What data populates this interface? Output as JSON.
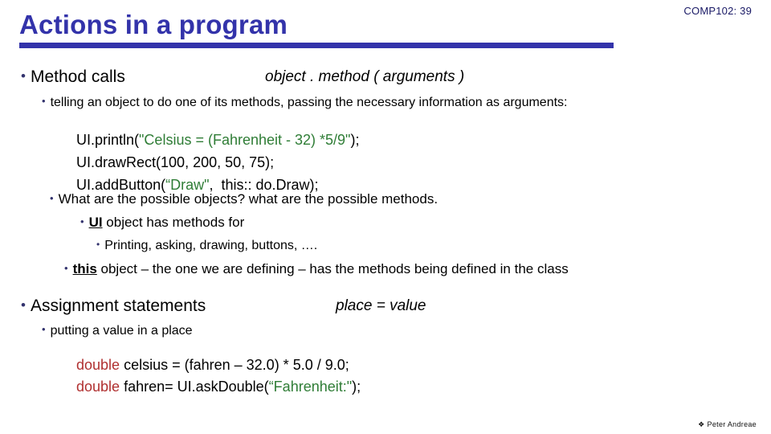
{
  "header": {
    "course_tag": "COMP102: 39",
    "title": "Actions in a program"
  },
  "sections": {
    "method_calls": {
      "heading": "Method calls",
      "syntax": "object . method  ( arguments  )",
      "description": "telling an object to do one of its methods, passing the necessary information as arguments:",
      "code_lines": [
        {
          "parts": [
            {
              "text": "UI.println(",
              "style": "plain"
            },
            {
              "text": "\"Celsius = (Fahrenheit - 32) *5/9\"",
              "style": "string"
            },
            {
              "text": ");",
              "style": "plain"
            }
          ]
        },
        {
          "parts": [
            {
              "text": "UI.drawRect(100, 200, 50, 75);",
              "style": "plain"
            }
          ]
        },
        {
          "parts": [
            {
              "text": "UI.addButton(",
              "style": "plain"
            },
            {
              "text": "“Draw\"",
              "style": "string"
            },
            {
              "text": ",  this:: do.Draw);",
              "style": "plain"
            }
          ]
        }
      ],
      "question": "What are the possible objects? what are the possible methods.",
      "ui_object": {
        "emph": "UI",
        "rest": " object has methods for"
      },
      "ui_methods": "Printing,  asking, drawing,  buttons,  ….",
      "this_object": {
        "emph": "this",
        "rest": "  object – the one we are defining – has the methods being defined in the class"
      }
    },
    "assignment": {
      "heading": "Assignment statements",
      "syntax": "place    =   value",
      "description": "putting a value in a place",
      "code_lines": [
        {
          "parts": [
            {
              "text": "double",
              "style": "keyword"
            },
            {
              "text": " celsius = (fahren – 32.0) * 5.0 / 9.0;",
              "style": "plain"
            }
          ]
        },
        {
          "parts": [
            {
              "text": "double",
              "style": "keyword"
            },
            {
              "text": " fahren= UI.askDouble(",
              "style": "plain"
            },
            {
              "text": "“Fahrenheit:\"",
              "style": "string"
            },
            {
              "text": ");",
              "style": "plain"
            }
          ]
        }
      ]
    }
  },
  "footer": {
    "mark": "❖",
    "author": "Peter Andreae"
  },
  "bullet_glyph": "•",
  "colors": {
    "title": "#3333aa",
    "bullet": "#33336e",
    "string_literal": "#2f7d36",
    "keyword": "#b03030",
    "body_text": "#000000"
  }
}
